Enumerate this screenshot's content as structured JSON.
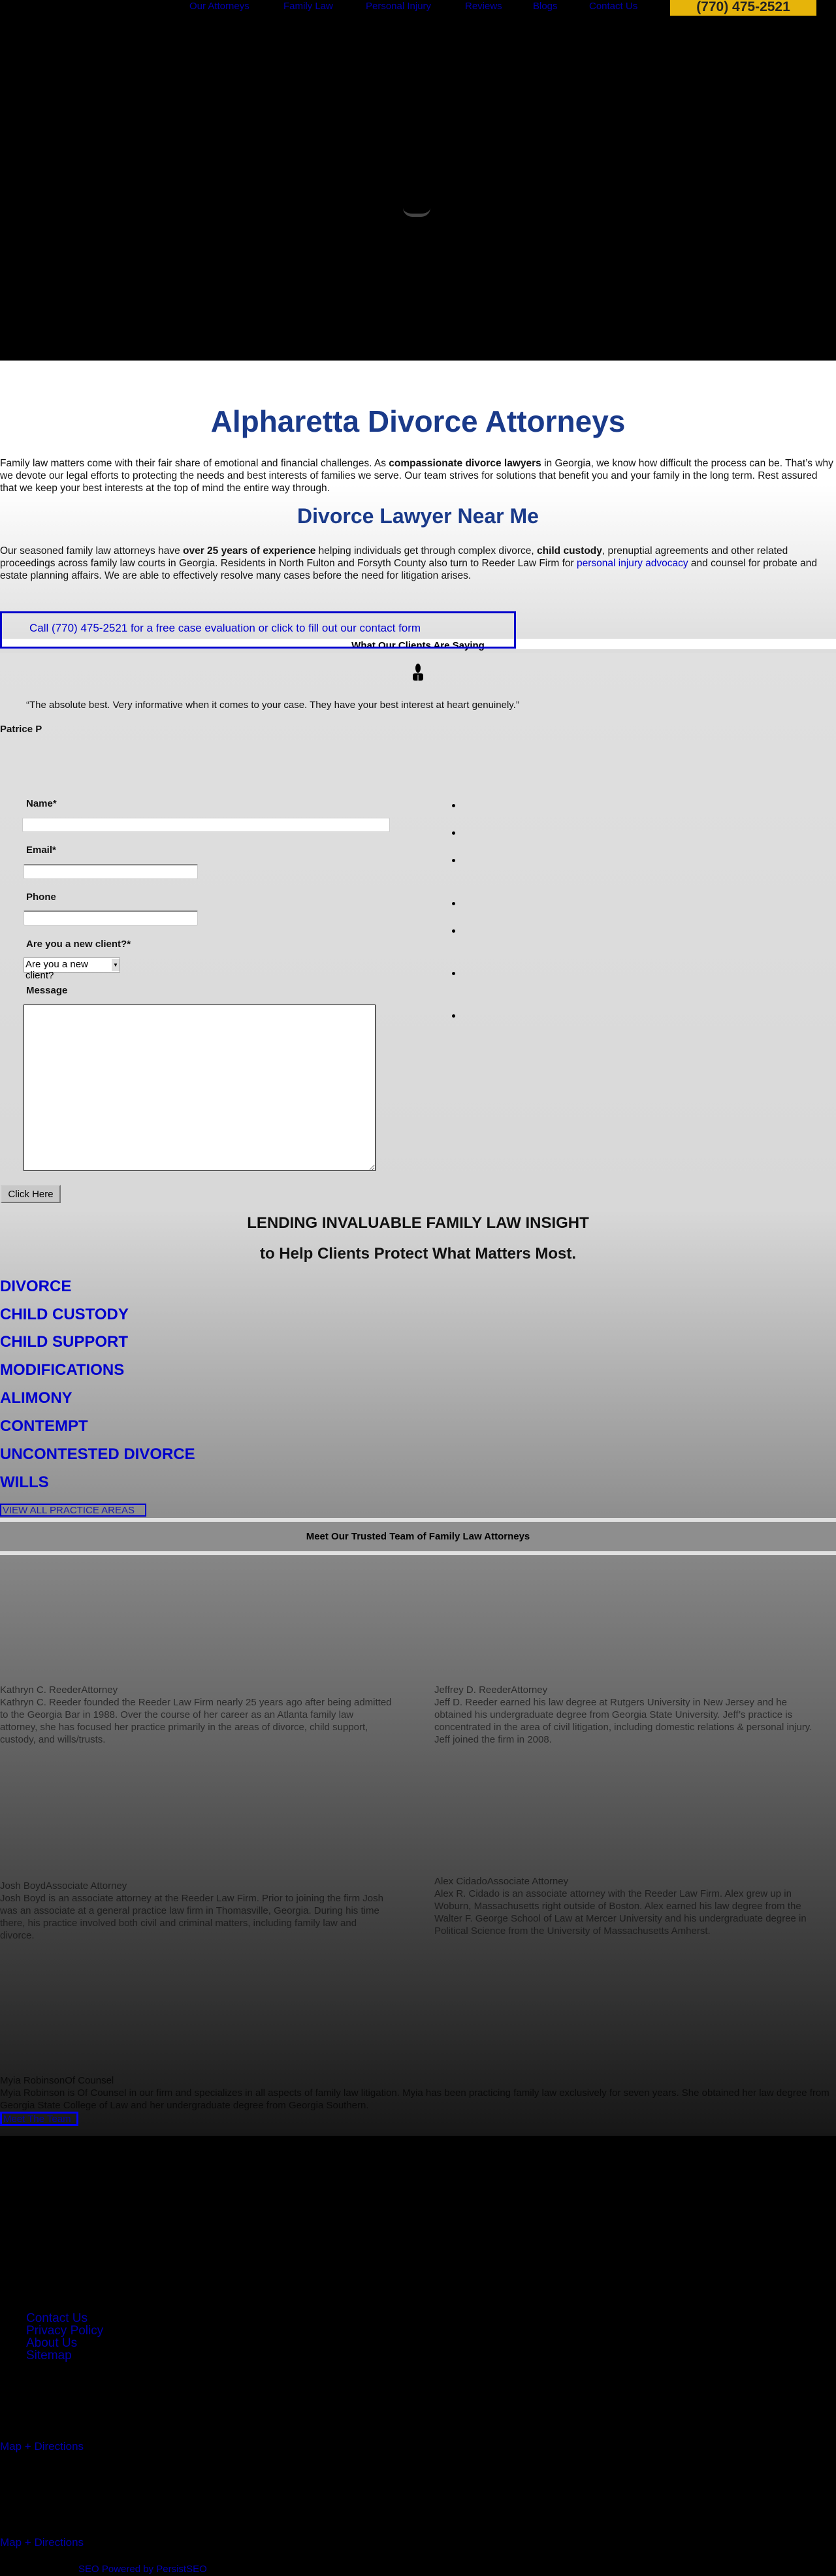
{
  "nav": {
    "items": [
      "Our Attorneys",
      "Family Law",
      "Personal Injury",
      "Reviews",
      "Blogs",
      "Contact Us"
    ],
    "phone": "(770) 475-2521",
    "brand_color": "#e6b40a"
  },
  "intro": {
    "title": "Alpharetta Divorce Attorneys",
    "p1_a": "Family law matters come with their fair share of emotional and financial challenges. As ",
    "p1_b": "compassionate divorce lawyers",
    "p1_c": " in Georgia, we know how difficult the process can be. That’s why we devote our legal efforts to protecting the needs and best interests of families we serve. Our team strives for solutions that benefit you and your family in the long term. Rest assured that we keep your best interests at the top of mind the entire way through.",
    "h2": "Divorce Lawyer Near Me",
    "p2_a": "Our seasoned family law attorneys have ",
    "p2_b": "over 25 years of experience",
    "p2_c": " helping individuals get through complex divorce, ",
    "p2_d": "child custody",
    "p2_e": ", prenuptial agreements and other related proceedings across family law courts in Georgia. Residents in North Fulton and Forsyth County also turn to Reeder Law Firm for ",
    "p2_link": "personal injury advocacy",
    "p2_f": " and counsel for probate and estate planning affairs. We are able to effectively resolve many cases before the need for litigation arises.",
    "cta": "Call (770) 475-2521 for a free case evaluation or click to fill out our contact form"
  },
  "testimonials": {
    "heading": "What Our Clients Are Saying",
    "quote": "“The absolute best. Very informative when it comes to your case. They have your best interest at heart genuinely.”",
    "author": "Patrice P"
  },
  "form": {
    "name_label": "Name*",
    "email_label": "Email*",
    "phone_label": "Phone",
    "client_label": "Are you a new client?*",
    "client_select": "Are you a new client?",
    "message_label": "Message",
    "submit": "Click Here"
  },
  "insight": {
    "line1": "LENDING INVALUABLE FAMILY LAW INSIGHT",
    "line2": "to Help Clients Protect What Matters Most."
  },
  "practice_areas": [
    "DIVORCE",
    "CHILD CUSTODY",
    "CHILD SUPPORT",
    "MODIFICATIONS",
    "ALIMONY",
    "CONTEMPT",
    "UNCONTESTED DIVORCE",
    "WILLS"
  ],
  "view_all": "VIEW ALL PRACTICE AREAS",
  "team": {
    "heading": "Meet Our Trusted Team of Family Law Attorneys",
    "members": [
      {
        "name": "Kathryn C. Reeder",
        "role": "Attorney",
        "bio": "Kathryn C. Reeder founded the Reeder Law Firm nearly 25 years ago after being admitted to the Georgia Bar in 1988. Over the course of her career as an Atlanta family law attorney, she has focused her practice primarily in the areas of divorce, child support, custody, and wills/trusts."
      },
      {
        "name": "Jeffrey D. Reeder",
        "role": "Attorney",
        "bio": "Jeff D. Reeder earned his law degree at Rutgers University in New Jersey and he obtained his undergraduate degree from Georgia State University. Jeff’s practice is concentrated in the area of civil litigation, including domestic relations & personal injury. Jeff joined the firm in 2008."
      },
      {
        "name": "Josh Boyd",
        "role": "Associate Attorney",
        "bio": "Josh Boyd is an associate attorney at the Reeder Law Firm. Prior to joining the firm Josh was an associate at a general practice law firm in Thomasville, Georgia. During his time there, his practice involved both civil and criminal matters, including family law and divorce."
      },
      {
        "name": "Alex Cidado",
        "role": "Associate Attorney",
        "bio": "Alex R. Cidado is an associate attorney with the Reeder Law Firm. Alex grew up in Woburn, Massachusetts right outside of Boston. Alex earned his law degree from the Walter F. George School of Law at Mercer University and his undergraduate degree in Political Science from the University of Massachusetts Amherst."
      },
      {
        "name": "Myia Robinson",
        "role": "Of Counsel",
        "bio": "Myia Robinson is Of Counsel in our firm and specializes in all aspects of family law litigation. Myia has been practicing family law exclusively for seven years. She obtained her law degree from Georgia State College of Law and her undergraduate degree from Georgia Southern."
      }
    ],
    "button": "Meet The Team"
  },
  "footer": {
    "links": [
      "Contact Us",
      "Privacy Policy",
      "About Us",
      "Sitemap"
    ],
    "map1": "Map + Directions",
    "map2": "Map + Directions",
    "credit": "SEO Powered by PersistSEO"
  }
}
